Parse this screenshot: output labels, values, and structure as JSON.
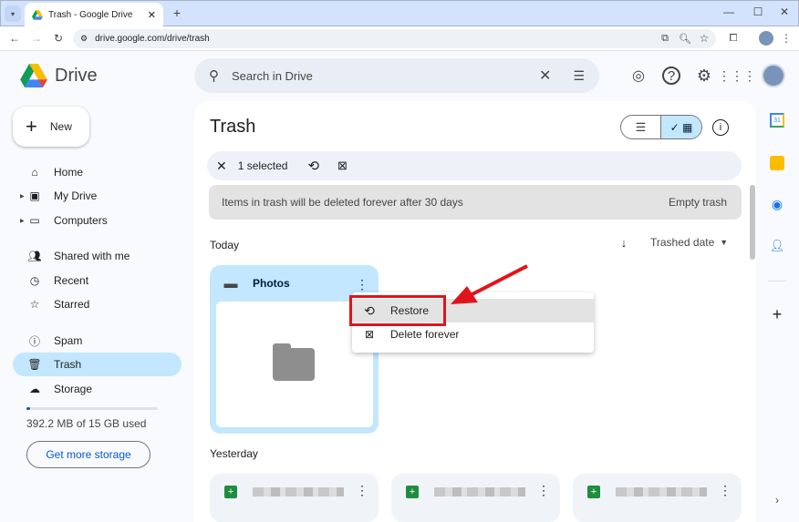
{
  "browser": {
    "tab_title": "Trash - Google Drive",
    "url": "drive.google.com/drive/trash",
    "new_tab": "+",
    "window_controls": [
      "minimize",
      "maximize",
      "close"
    ]
  },
  "app": {
    "name": "Drive",
    "new_button": "New",
    "search_placeholder": "Search in Drive"
  },
  "sidebar": {
    "items": [
      {
        "label": "Home",
        "icon": "home-icon"
      },
      {
        "label": "My Drive",
        "icon": "my-drive-icon"
      },
      {
        "label": "Computers",
        "icon": "computers-icon"
      },
      {
        "label": "Shared with me",
        "icon": "shared-icon"
      },
      {
        "label": "Recent",
        "icon": "clock-icon"
      },
      {
        "label": "Starred",
        "icon": "star-icon"
      },
      {
        "label": "Spam",
        "icon": "spam-icon"
      },
      {
        "label": "Trash",
        "icon": "trash-icon",
        "active": true
      },
      {
        "label": "Storage",
        "icon": "cloud-icon"
      }
    ],
    "storage_used_text": "392.2 MB of 15 GB used",
    "storage_fraction": 0.026,
    "get_storage": "Get more storage"
  },
  "main": {
    "title": "Trash",
    "selection": {
      "count_label": "1 selected"
    },
    "banner": {
      "text": "Items in trash will be deleted forever after 30 days",
      "action": "Empty trash"
    },
    "sort_label": "Trashed date",
    "sections": [
      {
        "label": "Today",
        "items": [
          {
            "name": "Photos",
            "type": "folder",
            "selected": true
          }
        ]
      },
      {
        "label": "Yesterday",
        "items": [
          {
            "type": "spreadsheet",
            "name": "(blurred)"
          },
          {
            "type": "spreadsheet",
            "name": "(blurred)"
          },
          {
            "type": "spreadsheet",
            "name": "(blurred)"
          }
        ]
      }
    ]
  },
  "context_menu": {
    "items": [
      {
        "label": "Restore",
        "icon": "restore-icon",
        "highlighted": true
      },
      {
        "label": "Delete forever",
        "icon": "delete-forever-icon"
      }
    ]
  },
  "colors": {
    "accent": "#c2e7ff",
    "annotation": "#e0141b"
  }
}
